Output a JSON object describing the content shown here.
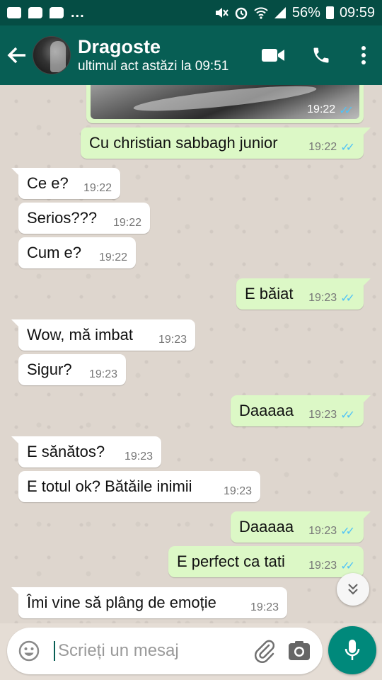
{
  "status_bar": {
    "battery": "56%",
    "time": "09:59",
    "overflow": "..."
  },
  "header": {
    "title": "Dragoste",
    "subtitle": "ultimul act astăzi la 09:51",
    "avatar_label": "SABBAGH"
  },
  "chat": {
    "image_message": {
      "time": "19:22"
    },
    "messages": [
      {
        "dir": "out",
        "text": "Cu christian sabbagh junior",
        "time": "19:22"
      },
      {
        "dir": "in",
        "text": "Ce e?",
        "time": "19:22"
      },
      {
        "dir": "in",
        "text": "Serios???",
        "time": "19:22"
      },
      {
        "dir": "in",
        "text": "Cum e?",
        "time": "19:22"
      },
      {
        "dir": "out",
        "text": "E băiat",
        "time": "19:23"
      },
      {
        "dir": "in",
        "text": "Wow, mă imbat",
        "time": "19:23"
      },
      {
        "dir": "in",
        "text": "Sigur?",
        "time": "19:23"
      },
      {
        "dir": "out",
        "text": "Daaaaa",
        "time": "19:23"
      },
      {
        "dir": "in",
        "text": "E sănătos?",
        "time": "19:23"
      },
      {
        "dir": "in",
        "text": "E totul ok? Bătăile inimii",
        "time": "19:23"
      },
      {
        "dir": "out",
        "text": "Daaaaa",
        "time": "19:23"
      },
      {
        "dir": "out",
        "text": "E perfect ca tati",
        "time": "19:23"
      },
      {
        "dir": "in",
        "text": "Îmi vine să plâng de emoție",
        "time": "19:23"
      }
    ]
  },
  "input": {
    "placeholder": "Scrieți un mesaj"
  },
  "icons": {
    "back": "arrow-left-icon",
    "video": "video-call-icon",
    "call": "phone-icon",
    "menu": "more-vert-icon",
    "emoji": "emoji-icon",
    "attach": "paperclip-icon",
    "camera": "camera-icon",
    "mic": "microphone-icon",
    "scroll": "chevron-double-down-icon"
  },
  "colors": {
    "header": "#075e54",
    "status_bar": "#054d44",
    "outgoing_bubble": "#dcf8c6",
    "incoming_bubble": "#ffffff",
    "read_ticks": "#4fc3f7",
    "mic_button": "#00897b"
  }
}
